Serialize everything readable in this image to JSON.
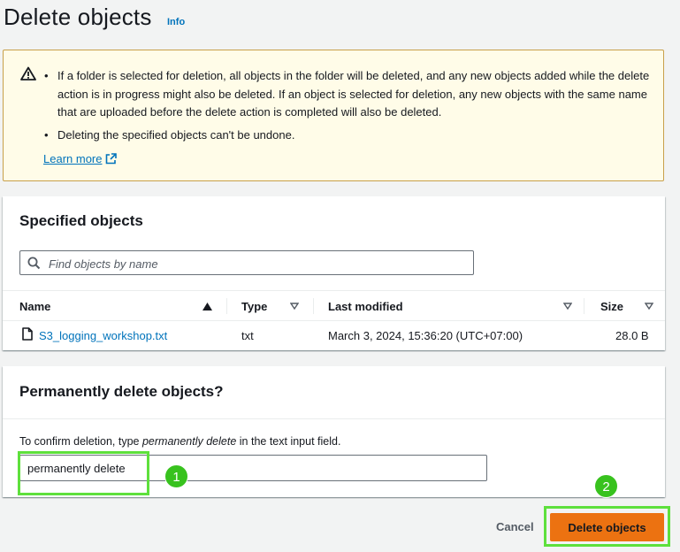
{
  "header": {
    "title": "Delete objects",
    "info_label": "Info"
  },
  "alert": {
    "icon": "warning-icon",
    "bullets": [
      "If a folder is selected for deletion, all objects in the folder will be deleted, and any new objects added while the delete action is in progress might also be deleted. If an object is selected for deletion, any new objects with the same name that are uploaded before the delete action is completed will also be deleted.",
      "Deleting the specified objects can't be undone."
    ],
    "learn_more": "Learn more"
  },
  "objects_panel": {
    "title": "Specified objects",
    "search_placeholder": "Find objects by name",
    "columns": [
      "Name",
      "Type",
      "Last modified",
      "Size"
    ],
    "rows": [
      {
        "name": "S3_logging_workshop.txt",
        "type": "txt",
        "last_modified": "March 3, 2024, 15:36:20 (UTC+07:00)",
        "size": "28.0 B"
      }
    ]
  },
  "delete_panel": {
    "title": "Permanently delete objects?",
    "instruction_prefix": "To confirm deletion, type ",
    "instruction_phrase": "permanently delete",
    "instruction_suffix": " in the text input field.",
    "input_value": "permanently delete"
  },
  "callouts": {
    "step1": "1",
    "step2": "2",
    "highlight_color": "#5ee03c",
    "badge_color": "#38c21e"
  },
  "footer": {
    "cancel_label": "Cancel",
    "delete_label": "Delete objects",
    "primary_color": "#ec7211"
  }
}
